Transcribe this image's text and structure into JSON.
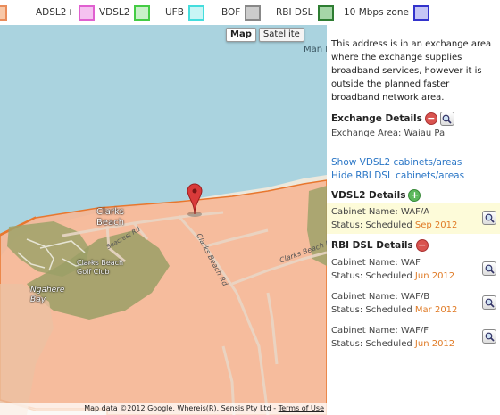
{
  "legend": [
    {
      "label": "",
      "color": "#e98c5b",
      "fill": "#f8c8a8"
    },
    {
      "label": "ADSL2+",
      "color": "#e060d0",
      "fill": "#f5c2f0"
    },
    {
      "label": "VDSL2",
      "color": "#44cc44",
      "fill": "#c9f0c9"
    },
    {
      "label": "UFB",
      "color": "#44dddd",
      "fill": "#c9f5f5"
    },
    {
      "label": "BOF",
      "color": "#888888",
      "fill": "#cccccc"
    },
    {
      "label": "RBI DSL",
      "color": "#2e7d32",
      "fill": "#a5d6a7"
    },
    {
      "label": "10 Mbps zone",
      "color": "#3333cc",
      "fill": "#c5c5f5"
    }
  ],
  "map": {
    "buttons": {
      "map": "Map",
      "satellite": "Satellite"
    },
    "labels": {
      "place": "Clarks Beach",
      "golf": "Clarks Beach Golf Club",
      "bay": "Ngahere Bay",
      "road1": "Clarks Beach Rd",
      "road2": "Clarks Beach Rd",
      "road3": "Seacrest Rd",
      "corner": "Man Har"
    },
    "attribution": "Map data ©2012 Google, Whereis(R), Sensis Pty Ltd",
    "terms": "Terms of Use",
    "zone_fill": "#f6b797",
    "zone_stroke": "#e8772e",
    "marker_color": "#d93a3a"
  },
  "panel": {
    "intro": "This address is in an exchange area where the exchange supplies broadband services, however it is outside the planned faster broadband network area.",
    "exchange": {
      "title": "Exchange Details",
      "area_label": "Exchange Area:",
      "area_value": "Waiau Pa"
    },
    "links": {
      "show_vdsl2": "Show VDSL2 cabinets/areas",
      "hide_rbi": "Hide RBI DSL cabinets/areas"
    },
    "vdsl2": {
      "title": "VDSL2 Details",
      "cabinets": [
        {
          "name_label": "Cabinet Name:",
          "name": "WAF/A",
          "status_label": "Status: Scheduled",
          "date": "Sep 2012"
        }
      ]
    },
    "rbi": {
      "title": "RBI DSL Details",
      "cabinets": [
        {
          "name_label": "Cabinet Name:",
          "name": "WAF",
          "status_label": "Status: Scheduled",
          "date": "Jun 2012"
        },
        {
          "name_label": "Cabinet Name:",
          "name": "WAF/B",
          "status_label": "Status: Scheduled",
          "date": "Mar 2012"
        },
        {
          "name_label": "Cabinet Name:",
          "name": "WAF/F",
          "status_label": "Status: Scheduled",
          "date": "Jun 2012"
        }
      ]
    }
  }
}
